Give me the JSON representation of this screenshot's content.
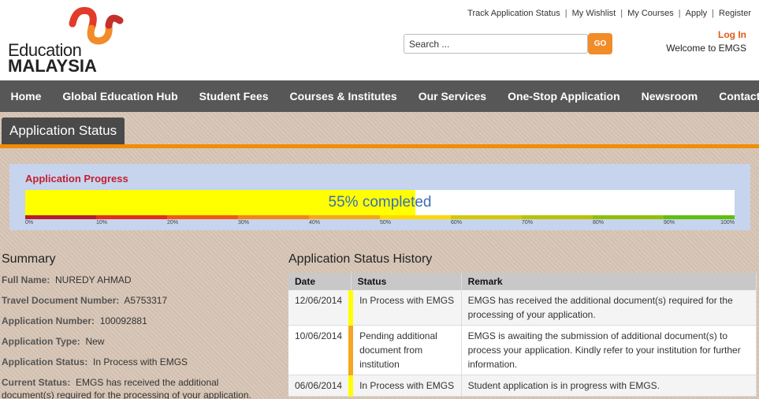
{
  "logo": {
    "line1": "Education",
    "line2": "MALAYSIA"
  },
  "toplinks": [
    "Track Application Status",
    "My Wishlist",
    "My Courses",
    "Apply",
    "Register"
  ],
  "search": {
    "placeholder": "Search ...",
    "value": "Search ...",
    "button": "GO"
  },
  "account": {
    "login": "Log In",
    "welcome": "Welcome to EMGS"
  },
  "nav": [
    "Home",
    "Global Education Hub",
    "Student Fees",
    "Courses & Institutes",
    "Our Services",
    "One-Stop Application",
    "Newsroom",
    "Contact Us"
  ],
  "section_title": "Application Status",
  "progress": {
    "title": "Application Progress",
    "percent": 55,
    "label": "55% completed",
    "scale_labels": [
      "0%",
      "10%",
      "20%",
      "30%",
      "40%",
      "50%",
      "60%",
      "70%",
      "80%",
      "90%",
      "100%"
    ],
    "scale_colors": [
      "#b81d2a",
      "#e0301e",
      "#f05a14",
      "#f4841a",
      "#f5a71c",
      "#ffd800",
      "#d4c800",
      "#b8c200",
      "#8fbf00",
      "#5fbf0c"
    ]
  },
  "summary": {
    "title": "Summary",
    "rows": [
      {
        "label": "Full Name:",
        "value": "NUREDY AHMAD"
      },
      {
        "label": "Travel Document Number:",
        "value": "A5753317"
      },
      {
        "label": "Application Number:",
        "value": "100092881"
      },
      {
        "label": "Application Type:",
        "value": "New"
      },
      {
        "label": "Application Status:",
        "value": "In Process with EMGS"
      },
      {
        "label": "Current Status:",
        "value": "EMGS has received the additional",
        "value2": "document(s) required for the processing of your application."
      }
    ]
  },
  "history": {
    "title": "Application Status History",
    "headers": [
      "Date",
      "Status",
      "Remark"
    ],
    "rows": [
      {
        "date": "12/06/2014",
        "status": "In Process with EMGS",
        "remark": "EMGS has received the additional document(s) required for the processing of your application."
      },
      {
        "date": "10/06/2014",
        "status": "Pending additional document from institution",
        "remark": "EMGS is awaiting the submission of additional document(s) to process your application. Kindly refer to your institution for further information."
      },
      {
        "date": "06/06/2014",
        "status": "In Process with EMGS",
        "remark": "Student application is in progress with EMGS."
      }
    ]
  },
  "colors": {
    "accent": "#f28c00",
    "nav_bg": "#575757",
    "progress_fill": "#ffff00",
    "title_red": "#c41e2e"
  }
}
